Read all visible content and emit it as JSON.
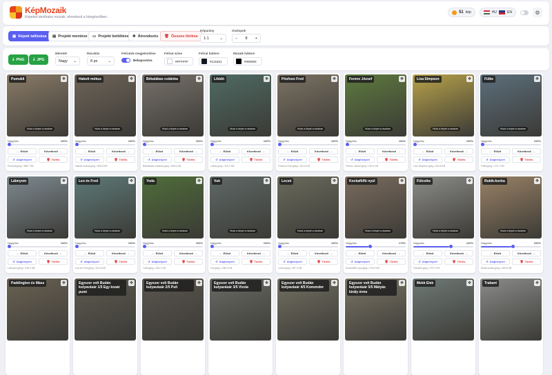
{
  "header": {
    "title": "KépMozaik",
    "subtitle": "Képeket tárolhatsz mozaik, elrendezd a böngészőben.",
    "count_value": "51",
    "count_label": "kép",
    "lang_hu": "HU",
    "lang_en": "EN"
  },
  "toolbar": {
    "upload": "Képek tallózása",
    "save_project": "Projekt mentése",
    "load_project": "Projekt betöltése",
    "arrange": "Átrendezés",
    "clear_all": "Összes törlése",
    "ratio_label": "Képarány",
    "ratio_value": "1:1",
    "columns_label": "Oszlopok",
    "columns_value": "8"
  },
  "export": {
    "png": "PNG",
    "jpg": "JPG",
    "size_label": "Méretek",
    "size_value": "Nagy",
    "gap_label": "Rácsköz",
    "gap_value": "8 px",
    "caption_label": "Feliratok megjelenítése",
    "caption_value": "Bekapcsolva",
    "text_color_label": "Felirat színe",
    "text_color_value": "#FFFFFF",
    "caption_bg_label": "Felirat háttere",
    "caption_bg_value": "#121821",
    "mosaic_bg_label": "Mozaik háttere",
    "mosaic_bg_value": "#000000",
    "text_color": "#ffffff",
    "caption_bg": "#121821",
    "mosaic_bg": "#000000"
  },
  "card_labels": {
    "zoom": "Nagyítás",
    "prev": "Előző",
    "next": "Következő",
    "reset": "Alaphelyzet",
    "delete": "Törlés",
    "hint": "Húzd a képet a rácsban"
  },
  "cards": [
    {
      "title": "Pumukli",
      "zoom": "100%",
      "zoom_frac": 0.0,
      "meta": "Pumukli.jpeg • 988.7 KB",
      "color": "#8a7b68"
    },
    {
      "title": "Hakott mókus",
      "zoom": "100%",
      "zoom_frac": 0.0,
      "meta": "Hakott mókus.jpeg • 505.8 KB",
      "color": "#6e6458"
    },
    {
      "title": "Békalábas csiáinka",
      "zoom": "100%",
      "zoom_frac": 0.0,
      "meta": "Békalábas csiáinka.jpeg • 596.5 KB",
      "color": "#77716a"
    },
    {
      "title": "Libidó",
      "zoom": "100%",
      "zoom_frac": 0.0,
      "meta": "Libidó.jpeg • 315.2 KB",
      "color": "#4f6b63"
    },
    {
      "title": "Pösfoso Fred",
      "zoom": "100%",
      "zoom_frac": 0.0,
      "meta": "Pösfoso Fred.jpeg • 347.8 KB",
      "color": "#7c7364"
    },
    {
      "title": "Ferenc József",
      "zoom": "100%",
      "zoom_frac": 0.0,
      "meta": "Ferenc József.jpeg • 220.4 KB",
      "color": "#5d7a3e"
    },
    {
      "title": "Lisa Simpson",
      "zoom": "100%",
      "zoom_frac": 0.0,
      "meta": "Lisa Simpson.jpeg • 315.8 KB",
      "color": "#b8a24a"
    },
    {
      "title": "Fülke",
      "zoom": "100%",
      "zoom_frac": 0.0,
      "meta": "Fülke.jpeg • 174.7 KB",
      "color": "#5c6f7c"
    },
    {
      "title": "Lábnyom",
      "zoom": "100%",
      "zoom_frac": 0.0,
      "meta": "Lábnyom.jpeg • 235.2 KB",
      "color": "#7e8a90"
    },
    {
      "title": "Leo és Fred",
      "zoom": "100%",
      "zoom_frac": 0.0,
      "meta": "Leo és Fred.jpeg • 321.6 KB",
      "color": "#5e7a78"
    },
    {
      "title": "Yoda",
      "zoom": "100%",
      "zoom_frac": 0.0,
      "meta": "Yoda.jpeg • 263.1 KB",
      "color": "#4f6d3a"
    },
    {
      "title": "Vuk",
      "zoom": "100%",
      "zoom_frac": 0.0,
      "meta": "Vuk.jpeg • 238.3 KB",
      "color": "#5f6966"
    },
    {
      "title": "Lecsó",
      "zoom": "100%",
      "zoom_frac": 0.0,
      "meta": "Lecsó.jpeg • 487.2 KB",
      "color": "#6a6a5c"
    },
    {
      "title": "Kockafölfü nyúl",
      "zoom": "175%",
      "zoom_frac": 0.375,
      "meta": "Kockafölfü nyúl.jpeg • 278.3 KB",
      "color": "#7b6c5e"
    },
    {
      "title": "Fülcsike",
      "zoom": "220%",
      "zoom_frac": 0.6,
      "meta": "Fülcsike.jpeg • 279.7 KB",
      "color": "#8c8c88"
    },
    {
      "title": "Rubik-kocka",
      "zoom": "200%",
      "zoom_frac": 0.5,
      "meta": "Rubik-kocka.jpeg • 183.6 KB",
      "color": "#9a8266"
    },
    {
      "title": "Paddington és Máss",
      "color": "#6a6253"
    },
    {
      "title": "Egyszer volt Budán kutyavásár 1/5 Egy kosár pumi",
      "color": "#5e5c50"
    },
    {
      "title": "Egyszer volt Budán kutyavásár 2/5 Puli",
      "color": "#5b564f"
    },
    {
      "title": "Egyszer volt Budán kutyavásár 3/5 Vizsla",
      "color": "#6a6c66"
    },
    {
      "title": "Egyszer volt Budán kutyavásár 4/5 Komondor",
      "color": "#737162"
    },
    {
      "title": "Egyszer volt Budán kutyavásár 5/5 Mátyás király érme",
      "color": "#7b7666"
    },
    {
      "title": "Mekk Elek",
      "color": "#6f7a76"
    },
    {
      "title": "Trabant",
      "color": "#8a8c8a"
    }
  ]
}
